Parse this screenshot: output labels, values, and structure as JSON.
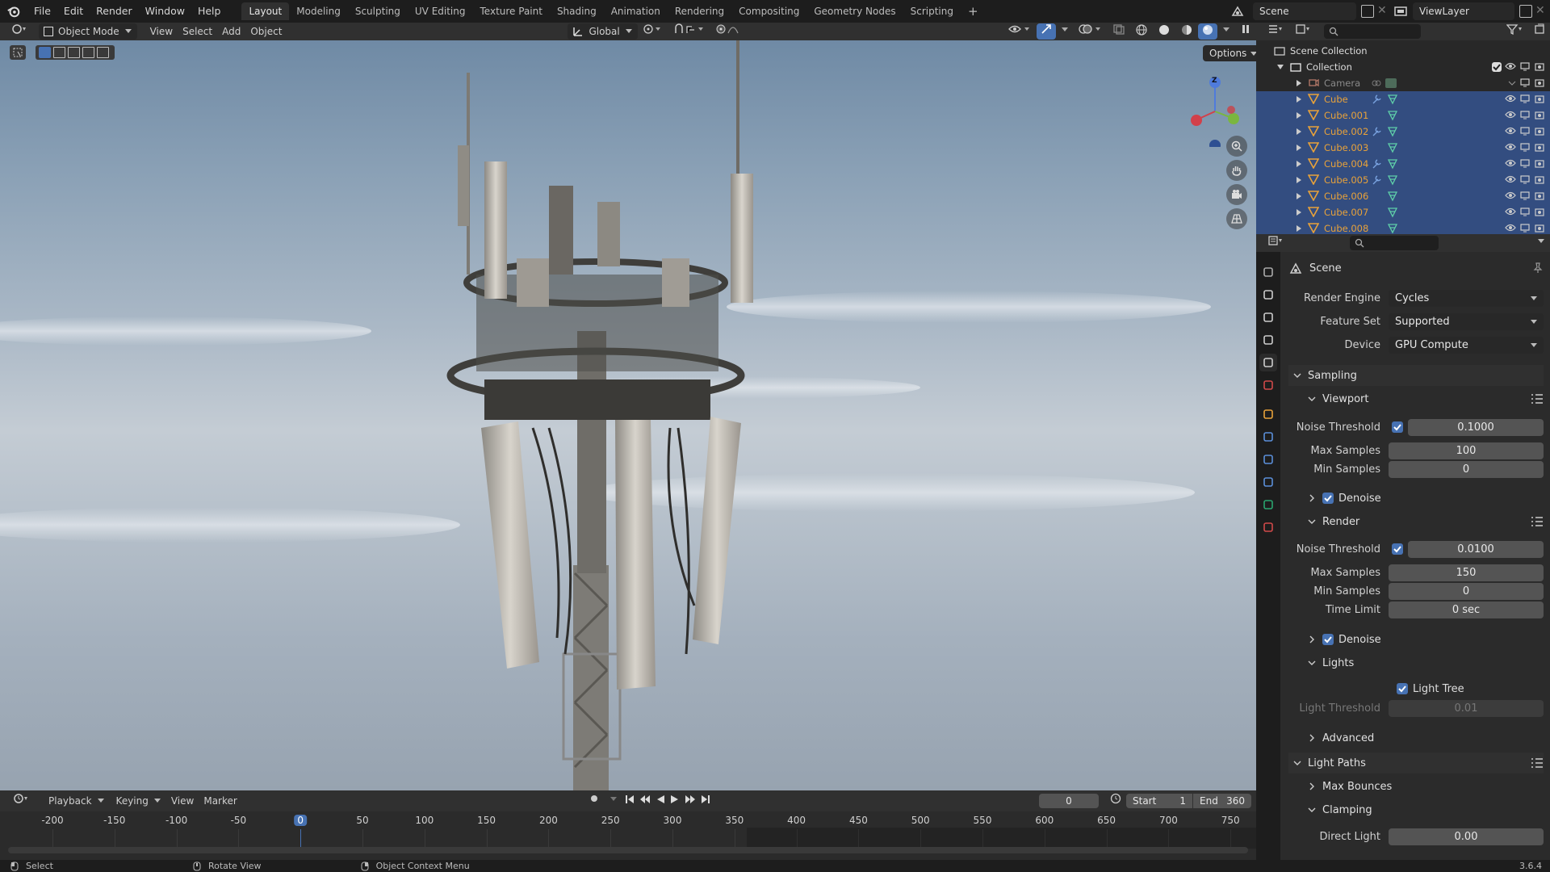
{
  "topbar": {
    "menus": [
      "File",
      "Edit",
      "Render",
      "Window",
      "Help"
    ],
    "workspaces": [
      "Layout",
      "Modeling",
      "Sculpting",
      "UV Editing",
      "Texture Paint",
      "Shading",
      "Animation",
      "Rendering",
      "Compositing",
      "Geometry Nodes",
      "Scripting"
    ],
    "active_workspace": "Layout",
    "add_tab": "+",
    "scene_name": "Scene",
    "view_layer": "ViewLayer"
  },
  "viewport_header": {
    "mode": "Object Mode",
    "menus": [
      "View",
      "Select",
      "Add",
      "Object"
    ],
    "orientation": "Global",
    "options_label": "Options"
  },
  "gizmo": {
    "z_label": "Z"
  },
  "timeline": {
    "menus": [
      "Playback",
      "Keying",
      "View",
      "Marker"
    ],
    "current_frame": "0",
    "start_label": "Start",
    "start_value": "1",
    "end_label": "End",
    "end_value": "360",
    "ticks": [
      "-200",
      "-150",
      "-100",
      "-50",
      "0",
      "50",
      "100",
      "150",
      "200",
      "250",
      "300",
      "350",
      "400",
      "450",
      "500",
      "550",
      "600",
      "650",
      "700",
      "750"
    ]
  },
  "statusbar": {
    "select": "Select",
    "rotate": "Rotate View",
    "context": "Object Context Menu",
    "version": "3.6.4"
  },
  "outliner": {
    "scene_collection": "Scene Collection",
    "collection": "Collection",
    "objects": [
      "Camera",
      "Cube",
      "Cube.001",
      "Cube.002",
      "Cube.003",
      "Cube.004",
      "Cube.005",
      "Cube.006",
      "Cube.007",
      "Cube.008"
    ]
  },
  "properties": {
    "context_title": "Scene",
    "render_engine_label": "Render Engine",
    "render_engine": "Cycles",
    "feature_set_label": "Feature Set",
    "feature_set": "Supported",
    "device_label": "Device",
    "device": "GPU Compute",
    "sampling": "Sampling",
    "viewport": "Viewport",
    "noise_threshold_label": "Noise Threshold",
    "vp_noise_threshold": "0.1000",
    "max_samples_label": "Max Samples",
    "vp_max_samples": "100",
    "min_samples_label": "Min Samples",
    "vp_min_samples": "0",
    "denoise": "Denoise",
    "render": "Render",
    "r_noise_threshold": "0.0100",
    "r_max_samples": "150",
    "r_min_samples": "0",
    "time_limit_label": "Time Limit",
    "r_time_limit": "0 sec",
    "lights": "Lights",
    "light_tree": "Light Tree",
    "light_threshold_label": "Light Threshold",
    "light_threshold": "0.01",
    "advanced": "Advanced",
    "light_paths": "Light Paths",
    "max_bounces": "Max Bounces",
    "clamping": "Clamping",
    "direct_light_label": "Direct Light",
    "direct_light": "0.00"
  },
  "colors": {
    "accent": "#4772b3",
    "object_orange": "#e8a23a",
    "selected_row": "#334d80"
  }
}
